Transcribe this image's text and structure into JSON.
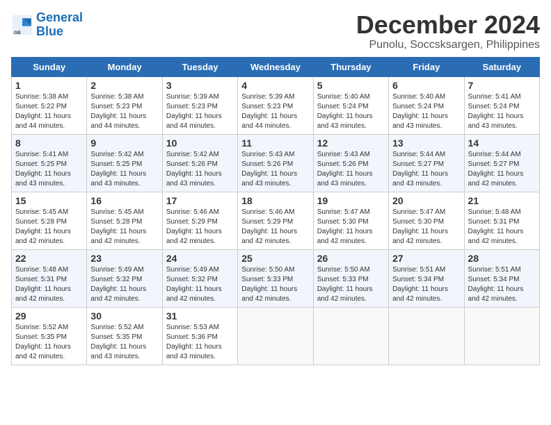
{
  "logo": {
    "line1": "General",
    "line2": "Blue"
  },
  "title": "December 2024",
  "location": "Punolu, Soccsksargen, Philippines",
  "headers": [
    "Sunday",
    "Monday",
    "Tuesday",
    "Wednesday",
    "Thursday",
    "Friday",
    "Saturday"
  ],
  "weeks": [
    [
      {
        "day": 1,
        "sunrise": "5:38 AM",
        "sunset": "5:22 PM",
        "daylight": "11 hours and 44 minutes."
      },
      {
        "day": 2,
        "sunrise": "5:38 AM",
        "sunset": "5:23 PM",
        "daylight": "11 hours and 44 minutes."
      },
      {
        "day": 3,
        "sunrise": "5:39 AM",
        "sunset": "5:23 PM",
        "daylight": "11 hours and 44 minutes."
      },
      {
        "day": 4,
        "sunrise": "5:39 AM",
        "sunset": "5:23 PM",
        "daylight": "11 hours and 44 minutes."
      },
      {
        "day": 5,
        "sunrise": "5:40 AM",
        "sunset": "5:24 PM",
        "daylight": "11 hours and 43 minutes."
      },
      {
        "day": 6,
        "sunrise": "5:40 AM",
        "sunset": "5:24 PM",
        "daylight": "11 hours and 43 minutes."
      },
      {
        "day": 7,
        "sunrise": "5:41 AM",
        "sunset": "5:24 PM",
        "daylight": "11 hours and 43 minutes."
      }
    ],
    [
      {
        "day": 8,
        "sunrise": "5:41 AM",
        "sunset": "5:25 PM",
        "daylight": "11 hours and 43 minutes."
      },
      {
        "day": 9,
        "sunrise": "5:42 AM",
        "sunset": "5:25 PM",
        "daylight": "11 hours and 43 minutes."
      },
      {
        "day": 10,
        "sunrise": "5:42 AM",
        "sunset": "5:26 PM",
        "daylight": "11 hours and 43 minutes."
      },
      {
        "day": 11,
        "sunrise": "5:43 AM",
        "sunset": "5:26 PM",
        "daylight": "11 hours and 43 minutes."
      },
      {
        "day": 12,
        "sunrise": "5:43 AM",
        "sunset": "5:26 PM",
        "daylight": "11 hours and 43 minutes."
      },
      {
        "day": 13,
        "sunrise": "5:44 AM",
        "sunset": "5:27 PM",
        "daylight": "11 hours and 43 minutes."
      },
      {
        "day": 14,
        "sunrise": "5:44 AM",
        "sunset": "5:27 PM",
        "daylight": "11 hours and 42 minutes."
      }
    ],
    [
      {
        "day": 15,
        "sunrise": "5:45 AM",
        "sunset": "5:28 PM",
        "daylight": "11 hours and 42 minutes."
      },
      {
        "day": 16,
        "sunrise": "5:45 AM",
        "sunset": "5:28 PM",
        "daylight": "11 hours and 42 minutes."
      },
      {
        "day": 17,
        "sunrise": "5:46 AM",
        "sunset": "5:29 PM",
        "daylight": "11 hours and 42 minutes."
      },
      {
        "day": 18,
        "sunrise": "5:46 AM",
        "sunset": "5:29 PM",
        "daylight": "11 hours and 42 minutes."
      },
      {
        "day": 19,
        "sunrise": "5:47 AM",
        "sunset": "5:30 PM",
        "daylight": "11 hours and 42 minutes."
      },
      {
        "day": 20,
        "sunrise": "5:47 AM",
        "sunset": "5:30 PM",
        "daylight": "11 hours and 42 minutes."
      },
      {
        "day": 21,
        "sunrise": "5:48 AM",
        "sunset": "5:31 PM",
        "daylight": "11 hours and 42 minutes."
      }
    ],
    [
      {
        "day": 22,
        "sunrise": "5:48 AM",
        "sunset": "5:31 PM",
        "daylight": "11 hours and 42 minutes."
      },
      {
        "day": 23,
        "sunrise": "5:49 AM",
        "sunset": "5:32 PM",
        "daylight": "11 hours and 42 minutes."
      },
      {
        "day": 24,
        "sunrise": "5:49 AM",
        "sunset": "5:32 PM",
        "daylight": "11 hours and 42 minutes."
      },
      {
        "day": 25,
        "sunrise": "5:50 AM",
        "sunset": "5:33 PM",
        "daylight": "11 hours and 42 minutes."
      },
      {
        "day": 26,
        "sunrise": "5:50 AM",
        "sunset": "5:33 PM",
        "daylight": "11 hours and 42 minutes."
      },
      {
        "day": 27,
        "sunrise": "5:51 AM",
        "sunset": "5:34 PM",
        "daylight": "11 hours and 42 minutes."
      },
      {
        "day": 28,
        "sunrise": "5:51 AM",
        "sunset": "5:34 PM",
        "daylight": "11 hours and 42 minutes."
      }
    ],
    [
      {
        "day": 29,
        "sunrise": "5:52 AM",
        "sunset": "5:35 PM",
        "daylight": "11 hours and 42 minutes."
      },
      {
        "day": 30,
        "sunrise": "5:52 AM",
        "sunset": "5:35 PM",
        "daylight": "11 hours and 43 minutes."
      },
      {
        "day": 31,
        "sunrise": "5:53 AM",
        "sunset": "5:36 PM",
        "daylight": "11 hours and 43 minutes."
      },
      null,
      null,
      null,
      null
    ]
  ]
}
